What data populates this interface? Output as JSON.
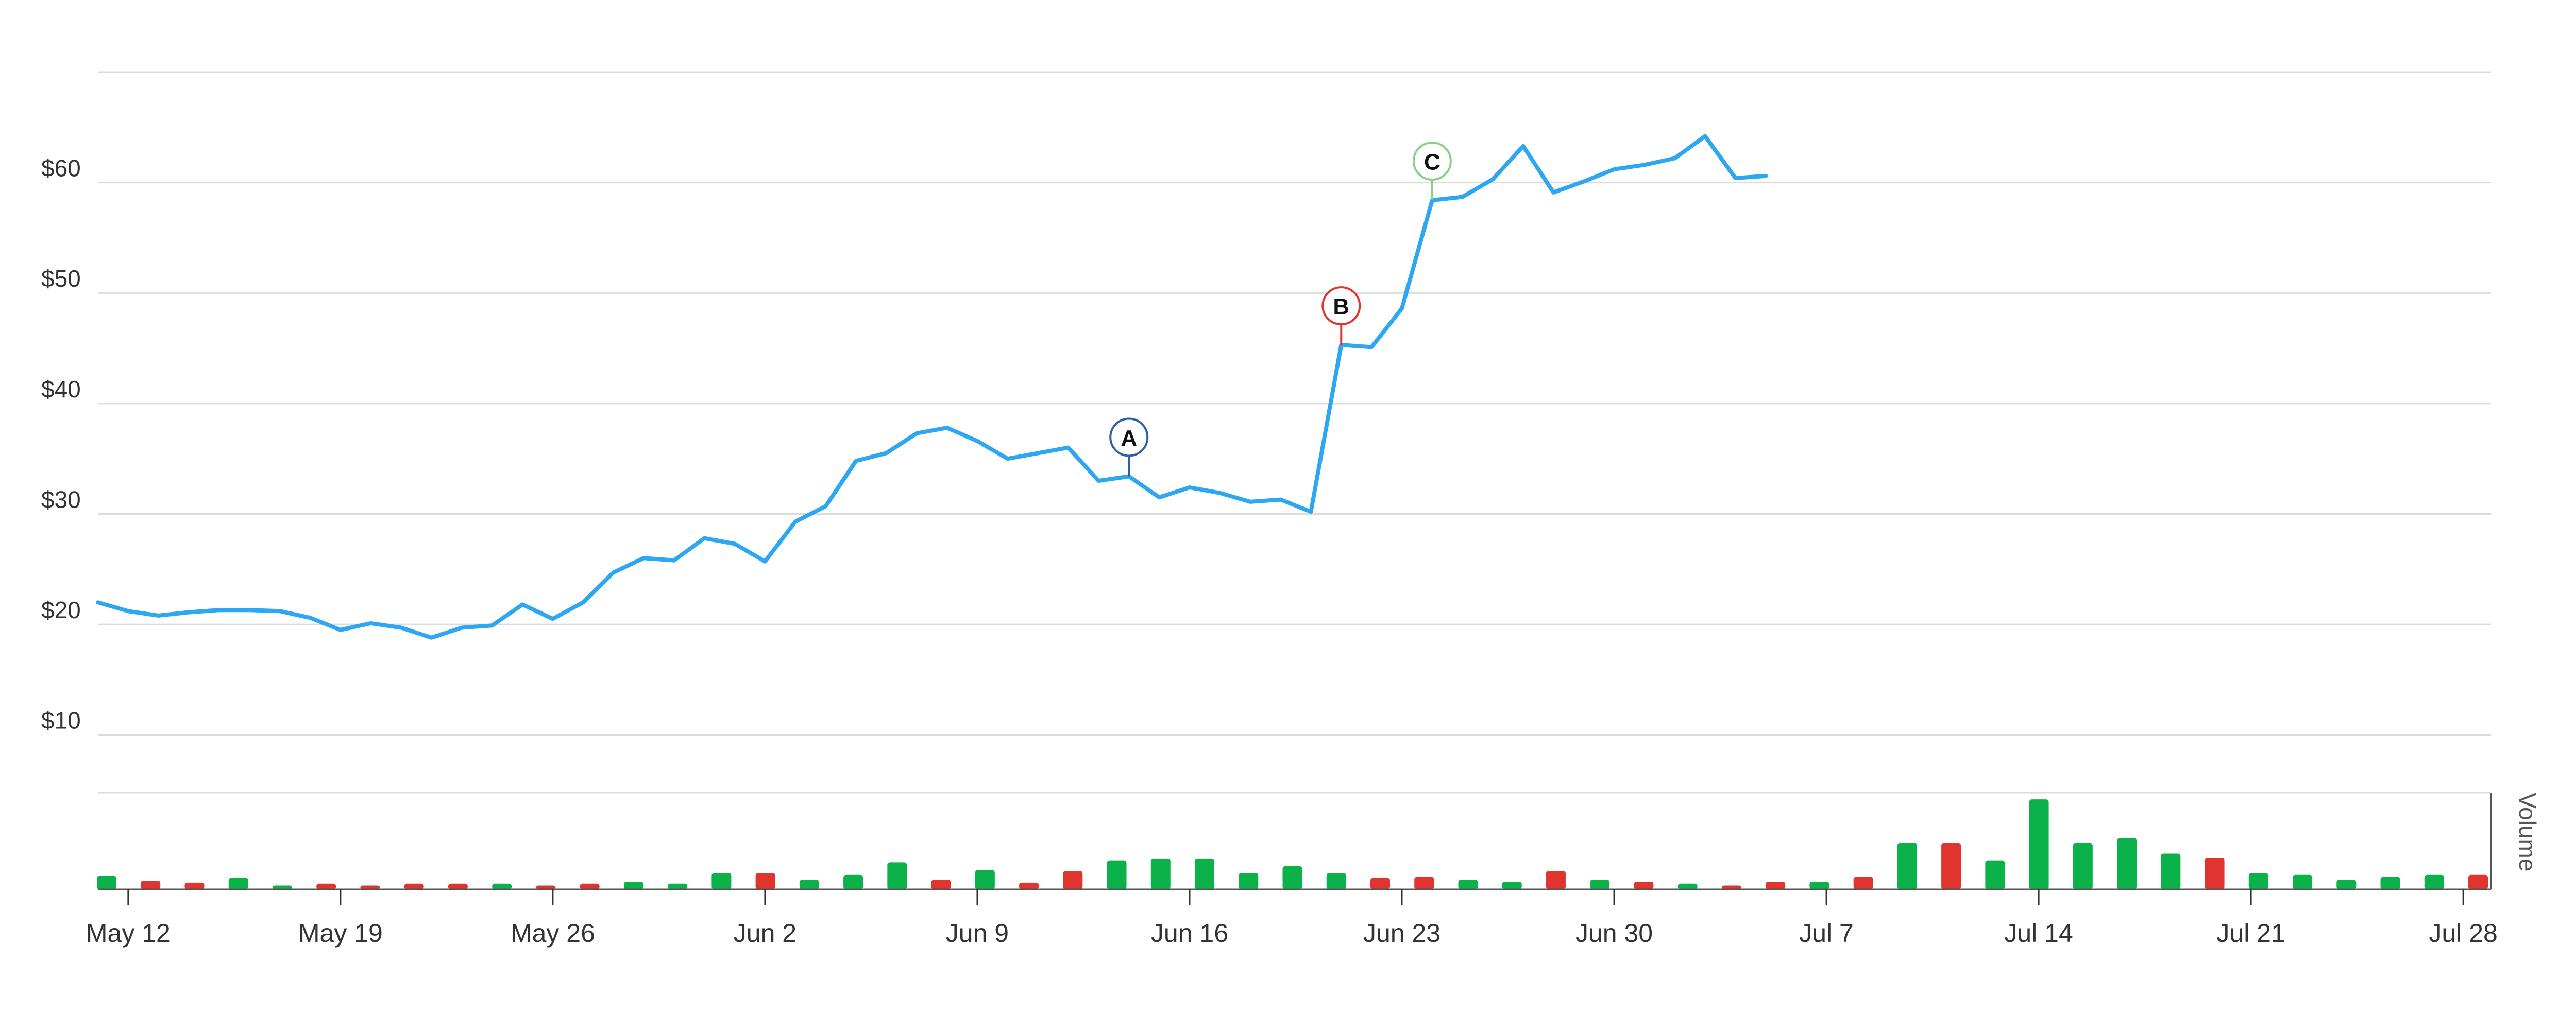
{
  "chart_data": {
    "type": "line",
    "subtype": "stock-price-with-volume",
    "colors": {
      "price_line": "#2ea7f2",
      "volume_up": "#0bb24a",
      "volume_down": "#e0342e",
      "grid": "#dcdcdc",
      "flag_a": "#2b5fa8",
      "flag_b": "#e0342e",
      "flag_c": "#8ccf88"
    },
    "price_axis": {
      "ylim": [
        5,
        70
      ],
      "ticks": [
        10,
        20,
        30,
        40,
        50,
        60
      ],
      "tick_labels": [
        "$10",
        "$20",
        "$30",
        "$40",
        "$50",
        "$60"
      ],
      "grid": true
    },
    "volume_axis": {
      "label": "Volume",
      "ylim": [
        0,
        1
      ]
    },
    "x_axis": {
      "type": "date",
      "range": [
        "2025-05-11",
        "2025-07-29"
      ],
      "ticks": [
        "2025-05-12",
        "2025-05-19",
        "2025-05-26",
        "2025-06-02",
        "2025-06-09",
        "2025-06-16",
        "2025-06-23",
        "2025-06-30",
        "2025-07-07",
        "2025-07-14",
        "2025-07-21",
        "2025-07-28"
      ],
      "tick_labels": [
        "May 12",
        "May 19",
        "May 26",
        "Jun 2",
        "Jun 9",
        "Jun 16",
        "Jun 23",
        "Jun 30",
        "Jul 7",
        "Jul 14",
        "Jul 21",
        "Jul 28"
      ]
    },
    "series": [
      {
        "type": "line",
        "points": [
          [
            "2025-05-11",
            22.0
          ],
          [
            "2025-05-12",
            21.2
          ],
          [
            "2025-05-13",
            20.8
          ],
          [
            "2025-05-14",
            21.1
          ],
          [
            "2025-05-15",
            21.3
          ],
          [
            "2025-05-16",
            21.3
          ],
          [
            "2025-05-17",
            21.2
          ],
          [
            "2025-05-18",
            20.6
          ],
          [
            "2025-05-19",
            19.5
          ],
          [
            "2025-05-20",
            20.1
          ],
          [
            "2025-05-21",
            19.7
          ],
          [
            "2025-05-22",
            18.8
          ],
          [
            "2025-05-23",
            19.7
          ],
          [
            "2025-05-24",
            19.9
          ],
          [
            "2025-05-25",
            21.8
          ],
          [
            "2025-05-26",
            20.5
          ],
          [
            "2025-05-27",
            22.0
          ],
          [
            "2025-05-28",
            24.7
          ],
          [
            "2025-05-29",
            26.0
          ],
          [
            "2025-05-30",
            25.8
          ],
          [
            "2025-05-31",
            27.8
          ],
          [
            "2025-06-01",
            27.3
          ],
          [
            "2025-06-02",
            25.7
          ],
          [
            "2025-06-03",
            29.3
          ],
          [
            "2025-06-04",
            30.7
          ],
          [
            "2025-06-05",
            34.8
          ],
          [
            "2025-06-06",
            35.5
          ],
          [
            "2025-06-07",
            37.3
          ],
          [
            "2025-06-08",
            37.8
          ],
          [
            "2025-06-09",
            36.6
          ],
          [
            "2025-06-10",
            35.0
          ],
          [
            "2025-06-11",
            35.5
          ],
          [
            "2025-06-12",
            36.0
          ],
          [
            "2025-06-13",
            33.0
          ],
          [
            "2025-06-14",
            33.4
          ],
          [
            "2025-06-15",
            31.5
          ],
          [
            "2025-06-16",
            32.4
          ],
          [
            "2025-06-17",
            31.9
          ],
          [
            "2025-06-18",
            31.1
          ],
          [
            "2025-06-19",
            31.3
          ],
          [
            "2025-06-20",
            30.2
          ],
          [
            "2025-06-21",
            45.3
          ],
          [
            "2025-06-22",
            45.1
          ],
          [
            "2025-06-23",
            48.6
          ],
          [
            "2025-06-24",
            58.4
          ],
          [
            "2025-06-25",
            58.7
          ],
          [
            "2025-06-26",
            60.3
          ],
          [
            "2025-06-27",
            63.3
          ],
          [
            "2025-06-28",
            59.1
          ],
          [
            "2025-06-29",
            60.1
          ],
          [
            "2025-06-30",
            61.2
          ],
          [
            "2025-07-01",
            61.6
          ],
          [
            "2025-07-02",
            62.2
          ],
          [
            "2025-07-03",
            64.2
          ],
          [
            "2025-07-04",
            60.4
          ],
          [
            "2025-07-05",
            60.6
          ]
        ]
      },
      {
        "type": "volume",
        "values": [
          [
            0.14,
            "up"
          ],
          [
            0.09,
            "down"
          ],
          [
            0.07,
            "down"
          ],
          [
            0.12,
            "up"
          ],
          [
            0.04,
            "up"
          ],
          [
            0.06,
            "down"
          ],
          [
            0.04,
            "down"
          ],
          [
            0.06,
            "down"
          ],
          [
            0.06,
            "down"
          ],
          [
            0.06,
            "up"
          ],
          [
            0.04,
            "down"
          ],
          [
            0.06,
            "down"
          ],
          [
            0.08,
            "up"
          ],
          [
            0.06,
            "up"
          ],
          [
            0.17,
            "up"
          ],
          [
            0.17,
            "down"
          ],
          [
            0.1,
            "up"
          ],
          [
            0.15,
            "up"
          ],
          [
            0.28,
            "up"
          ],
          [
            0.1,
            "down"
          ],
          [
            0.2,
            "up"
          ],
          [
            0.07,
            "down"
          ],
          [
            0.19,
            "down"
          ],
          [
            0.3,
            "up"
          ],
          [
            0.32,
            "up"
          ],
          [
            0.32,
            "up"
          ],
          [
            0.17,
            "up"
          ],
          [
            0.24,
            "up"
          ],
          [
            0.17,
            "up"
          ],
          [
            0.12,
            "down"
          ],
          [
            0.13,
            "down"
          ],
          [
            0.1,
            "up"
          ],
          [
            0.08,
            "up"
          ],
          [
            0.19,
            "down"
          ],
          [
            0.1,
            "up"
          ],
          [
            0.08,
            "down"
          ],
          [
            0.06,
            "up"
          ],
          [
            0.04,
            "down"
          ],
          [
            0.08,
            "down"
          ],
          [
            0.08,
            "up"
          ],
          [
            0.13,
            "down"
          ],
          [
            0.48,
            "up"
          ],
          [
            0.48,
            "down"
          ],
          [
            0.3,
            "up"
          ],
          [
            0.93,
            "up"
          ],
          [
            0.48,
            "up"
          ],
          [
            0.53,
            "up"
          ],
          [
            0.37,
            "up"
          ],
          [
            0.33,
            "down"
          ],
          [
            0.17,
            "up"
          ],
          [
            0.15,
            "up"
          ],
          [
            0.1,
            "up"
          ],
          [
            0.13,
            "up"
          ],
          [
            0.15,
            "up"
          ],
          [
            0.15,
            "down"
          ]
        ]
      }
    ],
    "flags": [
      {
        "label": "A",
        "date": "2025-06-14",
        "value": 33.4,
        "color_key": "flag_a"
      },
      {
        "label": "B",
        "date": "2025-06-21",
        "value": 45.3,
        "color_key": "flag_b"
      },
      {
        "label": "C",
        "date": "2025-06-24",
        "value": 58.4,
        "color_key": "flag_c"
      }
    ]
  }
}
